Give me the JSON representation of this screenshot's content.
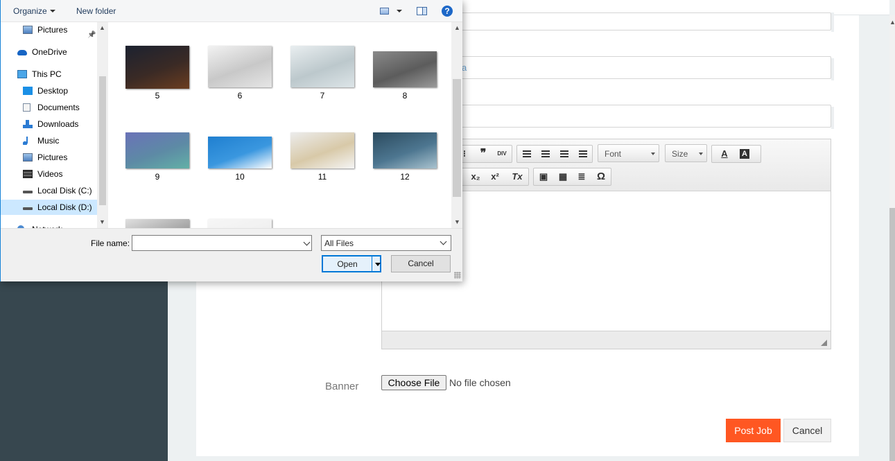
{
  "page": {
    "website_input_value": "a",
    "editor": {
      "font_label": "Font",
      "size_label": "Size",
      "blockquote_glyph": "❞",
      "div_label": "DIV",
      "text_color_glyph": "A",
      "bg_color_glyph": "A",
      "subscript_glyph": "x₂",
      "superscript_glyph": "x²",
      "clear_format_glyph": "Tx",
      "special_char_glyph": "Ω"
    },
    "banner_label": "Banner",
    "choose_file_label": "Choose File",
    "no_file_label": "No file chosen",
    "post_job_label": "Post Job",
    "cancel_label": "Cancel",
    "colors": {
      "sidebar": "#37474f",
      "accent": "#ff5722"
    }
  },
  "dialog": {
    "toolbar": {
      "organize_label": "Organize",
      "new_folder_label": "New folder",
      "help_glyph": "?"
    },
    "nav": [
      {
        "label": "Pictures",
        "icon": "pictures-icon",
        "pinned": true
      },
      {
        "label": "OneDrive",
        "icon": "onedrive-icon"
      },
      {
        "label": "This PC",
        "icon": "pc-icon"
      },
      {
        "label": "Desktop",
        "icon": "desktop-icon"
      },
      {
        "label": "Documents",
        "icon": "documents-icon"
      },
      {
        "label": "Downloads",
        "icon": "downloads-icon"
      },
      {
        "label": "Music",
        "icon": "music-icon"
      },
      {
        "label": "Pictures",
        "icon": "pictures-icon"
      },
      {
        "label": "Videos",
        "icon": "videos-icon"
      },
      {
        "label": "Local Disk (C:)",
        "icon": "drive-icon"
      },
      {
        "label": "Local Disk (D:)",
        "icon": "drive-icon",
        "selected": true
      },
      {
        "label": "Network",
        "icon": "network-icon"
      }
    ],
    "files": [
      {
        "name": "5",
        "colors": [
          "#1c2230",
          "#3a2a25",
          "#6b3d20"
        ]
      },
      {
        "name": "6",
        "colors": [
          "#f2f2f2",
          "#c8c8c8",
          "#e6e6e6"
        ]
      },
      {
        "name": "7",
        "colors": [
          "#e9eef0",
          "#bcc8cc",
          "#dde5e8"
        ]
      },
      {
        "name": "8",
        "colors": [
          "#8a8a8a",
          "#5c5c5c",
          "#9a9a9a"
        ]
      },
      {
        "name": "9",
        "colors": [
          "#6a72b8",
          "#5d8aa5",
          "#62b0a6"
        ]
      },
      {
        "name": "10",
        "colors": [
          "#1f7fd0",
          "#3a97df",
          "#ffffff"
        ]
      },
      {
        "name": "11",
        "colors": [
          "#ececec",
          "#d8c9a8",
          "#f5f5f5"
        ]
      },
      {
        "name": "12",
        "colors": [
          "#2b4a5e",
          "#4d7690",
          "#aac3cf"
        ]
      },
      {
        "name": "",
        "colors": [
          "#e0e0e0",
          "#999999",
          "#f5f5f5"
        ]
      },
      {
        "name": "",
        "colors": [
          "#f6f6f6",
          "#efefef",
          "#fafafa"
        ]
      }
    ],
    "file_name_label": "File name:",
    "file_name_value": "",
    "filter_value": "All Files",
    "open_label": "Open",
    "cancel_label": "Cancel"
  }
}
